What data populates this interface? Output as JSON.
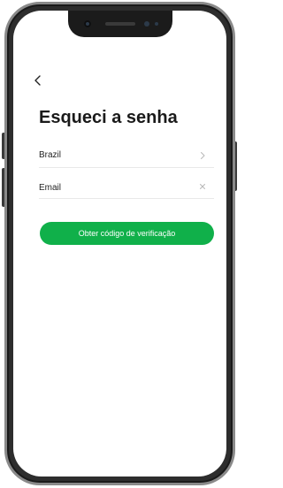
{
  "header": {
    "back_icon": "chevron-left-icon",
    "title": "Esqueci a senha"
  },
  "form": {
    "country": {
      "value": "Brazil",
      "trailing_icon": "chevron-right-icon"
    },
    "email": {
      "placeholder": "Email",
      "trailing_icon": "clear-icon"
    },
    "submit_label": "Obter código de verificação"
  },
  "theme": {
    "accent": "#10b04a",
    "text": "#1a1a1a",
    "divider": "#e8e8e8"
  }
}
